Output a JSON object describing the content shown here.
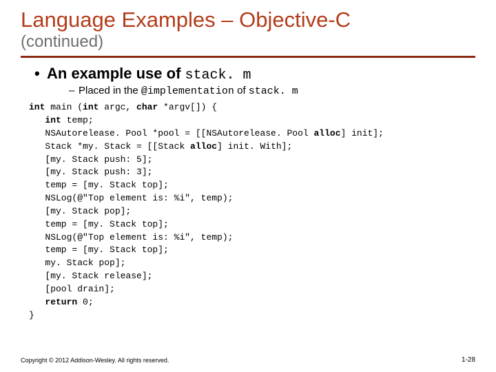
{
  "title": "Language Examples – Objective-C",
  "subtitle": "(continued)",
  "main_bullet": {
    "prefix": "An example use of ",
    "code": "stack. m"
  },
  "sub_bullet": {
    "prefix": "Placed in the ",
    "code1": "@implementation",
    "mid": " of ",
    "code2": "stack. m"
  },
  "code": {
    "l0_kw1": "int",
    "l0_a": " main (",
    "l0_kw2": "int",
    "l0_b": " argc, ",
    "l0_kw3": "char",
    "l0_c": " *argv[]) {",
    "l1_kw": "int",
    "l1_a": " temp;",
    "l2_a": "NSAutorelease. Pool *pool = [[NSAutorelease. Pool ",
    "l2_kw": "alloc",
    "l2_b": "] init];",
    "l3_a": "Stack *my. Stack = [[Stack ",
    "l3_kw": "alloc",
    "l3_b": "] init. With];",
    "l4": "[my. Stack push: 5];",
    "l5": "[my. Stack push: 3];",
    "l6": "temp = [my. Stack top];",
    "l7": "NSLog(@\"Top element is: %i\", temp);",
    "l8": "[my. Stack pop];",
    "l9": "temp = [my. Stack top];",
    "l10": "NSLog(@\"Top element is: %i\", temp);",
    "l11": "temp = [my. Stack top];",
    "l12": "my. Stack pop];",
    "l13": "[my. Stack release];",
    "l14": "[pool drain];",
    "l15_kw": "return",
    "l15_a": " 0;",
    "l16": "}"
  },
  "footer": {
    "copyright": "Copyright © 2012 Addison-Wesley. All rights reserved.",
    "page": "1-28"
  }
}
